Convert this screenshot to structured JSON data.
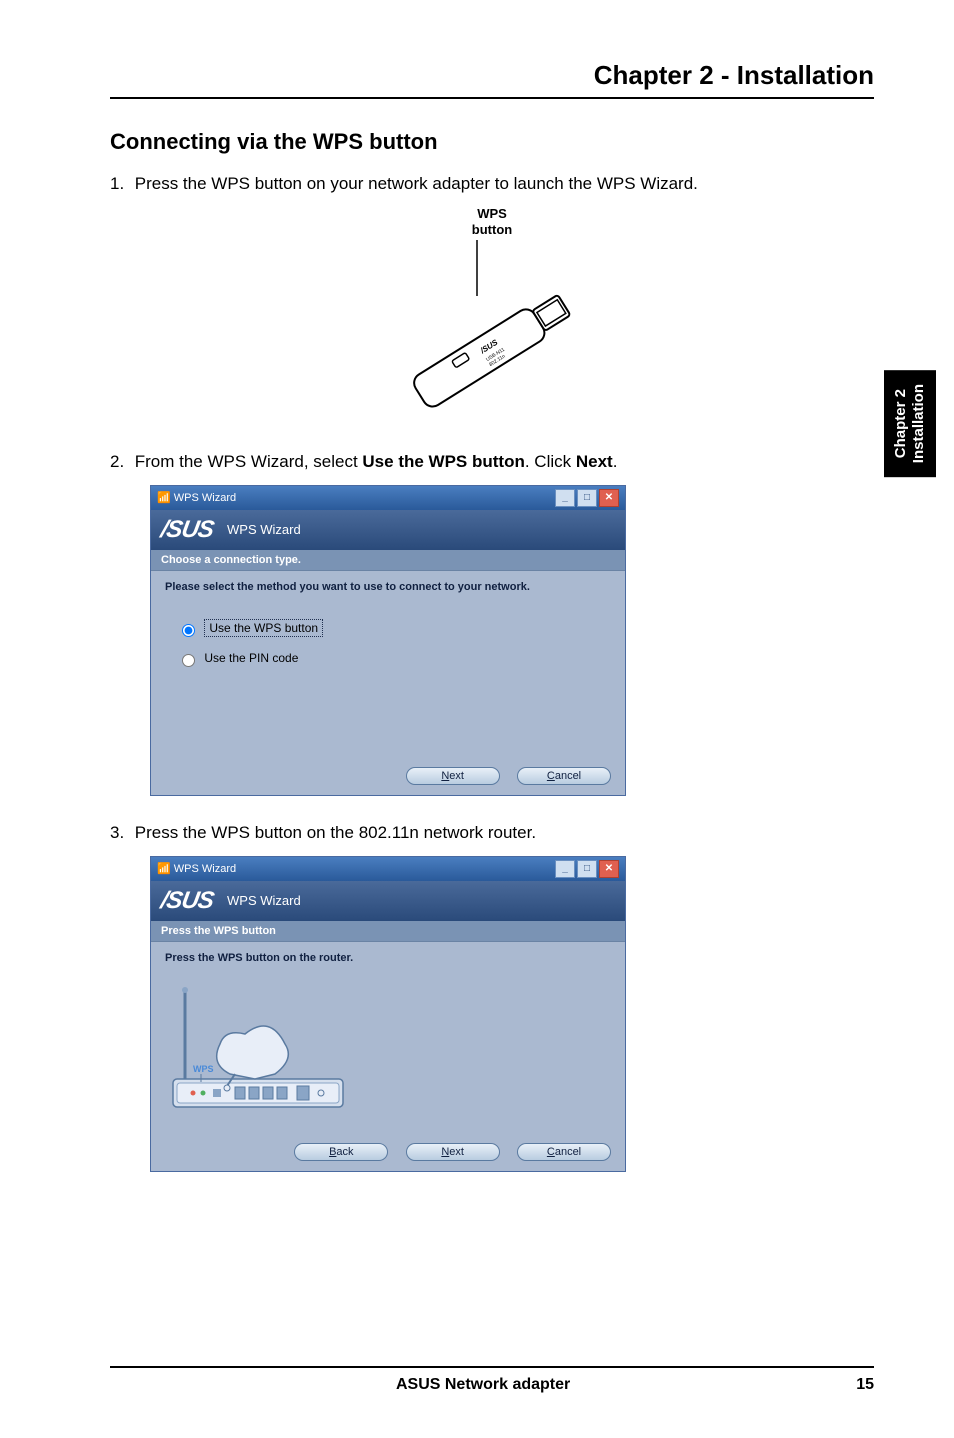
{
  "header": {
    "chapter_title": "Chapter 2 - Installation"
  },
  "section": {
    "title": "Connecting via the WPS button"
  },
  "steps": {
    "s1_num": "1.",
    "s1_text": "Press the WPS button on your network adapter to launch the WPS Wizard.",
    "s2_num": "2.",
    "s2_text_pre": "From the WPS Wizard, select ",
    "s2_bold1": "Use the WPS button",
    "s2_mid": ". Click ",
    "s2_bold2": "Next",
    "s2_post": ".",
    "s3_num": "3.",
    "s3_text": "Press the WPS button on the 802.11n network router."
  },
  "figure1": {
    "label_line1": "WPS",
    "label_line2": "button"
  },
  "wizard_common": {
    "window_title": "WPS Wizard",
    "brand": "/SUS",
    "brand_tag": "WPS Wizard",
    "btn_min": "_",
    "btn_max": "□",
    "btn_close": "✕"
  },
  "wizard1": {
    "caption": "Choose a connection type.",
    "instruction": "Please select the method you want to use to connect to your network.",
    "opt1": "Use the WPS button",
    "opt2": "Use the PIN code",
    "next": "Next",
    "cancel": "Cancel"
  },
  "wizard2": {
    "caption": "Press the WPS button",
    "instruction": "Press the WPS button on the router.",
    "wps_label": "WPS",
    "back": "Back",
    "next": "Next",
    "cancel": "Cancel"
  },
  "sidebar": {
    "line1": "Chapter 2",
    "line2": "Installation"
  },
  "footer": {
    "product": "ASUS Network adapter",
    "page_num": "15"
  }
}
